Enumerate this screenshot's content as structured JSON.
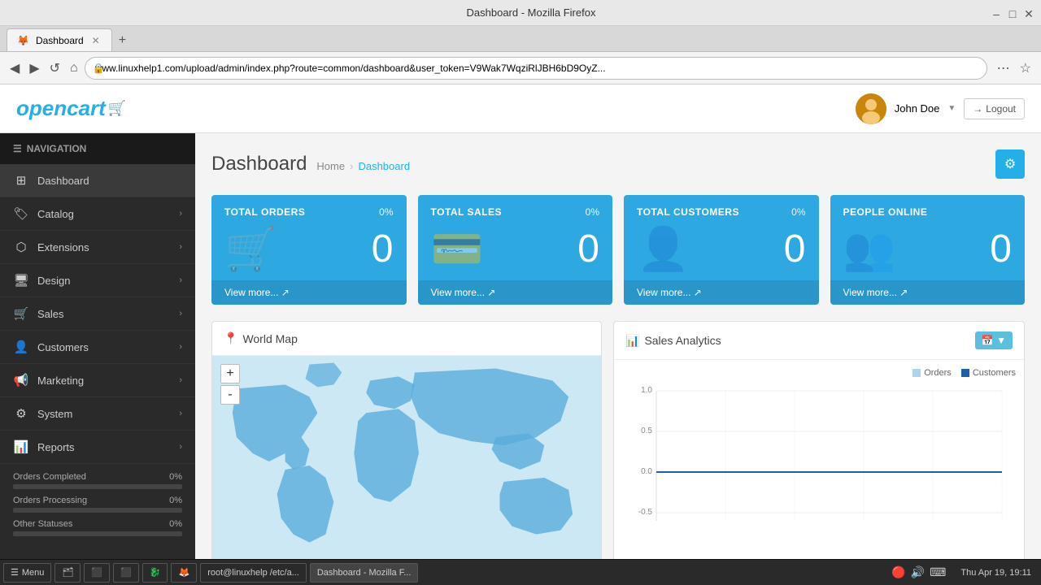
{
  "browser": {
    "title": "Dashboard - Mozilla Firefox",
    "tab_label": "Dashboard",
    "url": "www.linuxhelp1.com/upload/admin/index.php?route=common/dashboard&user_token=V9Wak7WqziRlJBH6bD9OyZ..."
  },
  "topbar": {
    "logo": "opencart",
    "user_name": "John Doe",
    "logout_label": "Logout"
  },
  "sidebar": {
    "nav_header": "NAVIGATION",
    "items": [
      {
        "id": "dashboard",
        "label": "Dashboard",
        "icon": "⊞",
        "has_arrow": false
      },
      {
        "id": "catalog",
        "label": "Catalog",
        "icon": "🏷",
        "has_arrow": true
      },
      {
        "id": "extensions",
        "label": "Extensions",
        "icon": "🧩",
        "has_arrow": true
      },
      {
        "id": "design",
        "label": "Design",
        "icon": "🖥",
        "has_arrow": true
      },
      {
        "id": "sales",
        "label": "Sales",
        "icon": "🛒",
        "has_arrow": true
      },
      {
        "id": "customers",
        "label": "Customers",
        "icon": "👤",
        "has_arrow": true
      },
      {
        "id": "marketing",
        "label": "Marketing",
        "icon": "📢",
        "has_arrow": true
      },
      {
        "id": "system",
        "label": "System",
        "icon": "⚙",
        "has_arrow": true
      },
      {
        "id": "reports",
        "label": "Reports",
        "icon": "📊",
        "has_arrow": true
      }
    ],
    "stats": [
      {
        "label": "Orders Completed",
        "pct": "0%",
        "value": 0
      },
      {
        "label": "Orders Processing",
        "pct": "0%",
        "value": 0
      },
      {
        "label": "Other Statuses",
        "pct": "0%",
        "value": 0
      }
    ]
  },
  "page": {
    "title": "Dashboard",
    "breadcrumb_home": "Home",
    "breadcrumb_current": "Dashboard"
  },
  "stat_cards": [
    {
      "title": "TOTAL ORDERS",
      "pct": "0%",
      "value": "0",
      "icon": "🛒",
      "view_more": "View more..."
    },
    {
      "title": "TOTAL SALES",
      "pct": "0%",
      "value": "0",
      "icon": "💳",
      "view_more": "View more..."
    },
    {
      "title": "TOTAL CUSTOMERS",
      "pct": "0%",
      "value": "0",
      "icon": "👤",
      "view_more": "View more..."
    },
    {
      "title": "PEOPLE ONLINE",
      "pct": "",
      "value": "0",
      "icon": "👥",
      "view_more": "View more..."
    }
  ],
  "map_panel": {
    "title": "World Map",
    "zoom_in": "+",
    "zoom_out": "-"
  },
  "chart_panel": {
    "title": "Sales Analytics",
    "legend_orders": "Orders",
    "legend_customers": "Customers",
    "y_labels": [
      "1.0",
      "0.5",
      "0.0",
      "-0.5"
    ],
    "date_btn": "📅"
  },
  "taskbar": {
    "menu_label": "Menu",
    "apps": [
      "🗂",
      "⬛",
      "⬛",
      "🐉",
      "🦊"
    ],
    "app_labels": [
      "Files",
      "Terminal",
      "Terminal2",
      "Dragon",
      "Firefox"
    ],
    "open_windows": [
      "root@linuxhelp /etc/a...",
      "Dashboard - Mozilla F..."
    ],
    "tray_icons": [
      "🔴",
      "🔊",
      "⌨"
    ],
    "clock": "Thu Apr 19, 19:11"
  }
}
